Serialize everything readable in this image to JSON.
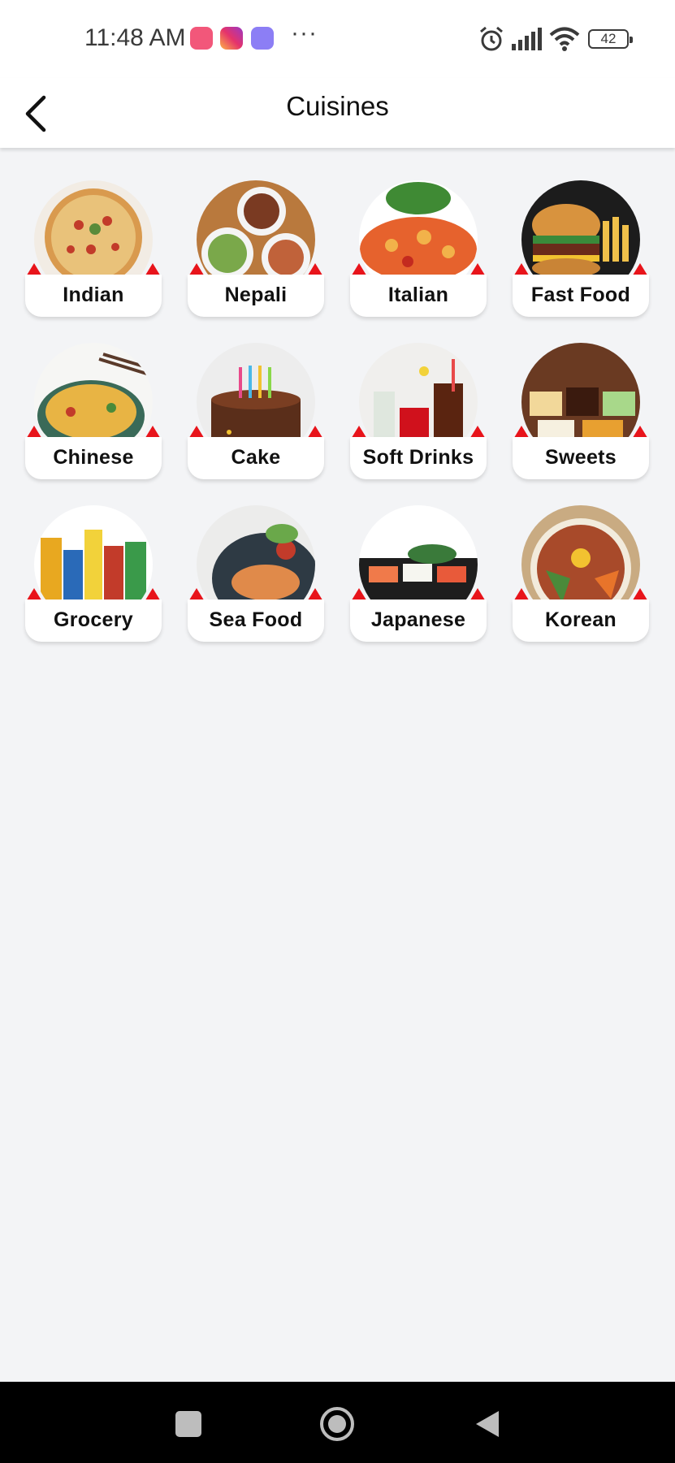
{
  "status_bar": {
    "time": "11:48 AM",
    "dots": "···",
    "battery": "42",
    "icons": [
      "app-notification-icon",
      "instagram-icon",
      "meme-app-icon",
      "alarm-icon",
      "signal-icon",
      "wifi-icon",
      "battery-icon"
    ]
  },
  "header": {
    "title": "Cuisines",
    "back_icon": "chevron-left-icon"
  },
  "colors": {
    "accent_red": "#e8141b",
    "background": "#f3f4f6",
    "card": "#ffffff"
  },
  "cuisines": [
    {
      "label": "Indian"
    },
    {
      "label": "Nepali"
    },
    {
      "label": "Italian"
    },
    {
      "label": "Fast Food"
    },
    {
      "label": "Chinese"
    },
    {
      "label": "Cake"
    },
    {
      "label": "Soft Drinks"
    },
    {
      "label": "Sweets"
    },
    {
      "label": "Grocery"
    },
    {
      "label": "Sea Food"
    },
    {
      "label": "Japanese"
    },
    {
      "label": "Korean"
    }
  ],
  "nav": {
    "icons": [
      "recent-apps-icon",
      "home-icon",
      "back-triangle-icon"
    ]
  }
}
